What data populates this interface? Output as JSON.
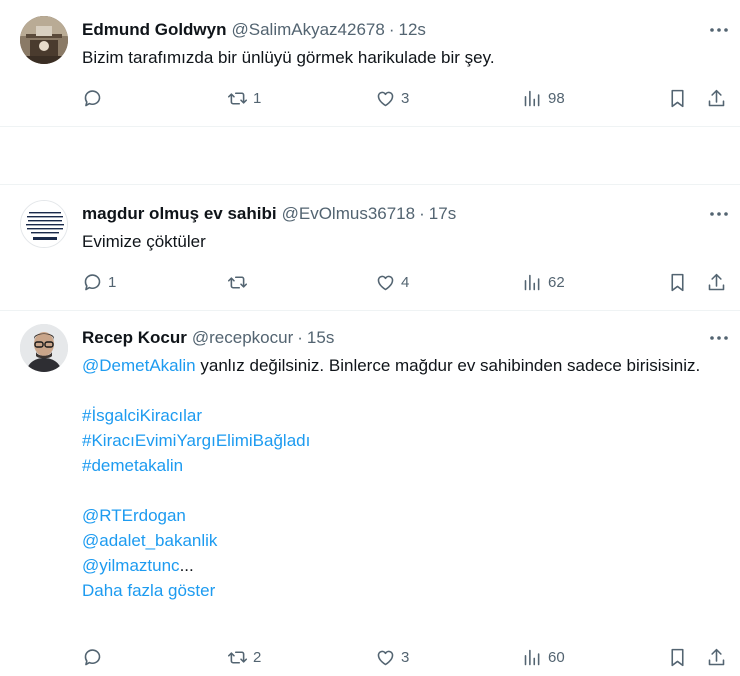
{
  "tweets": [
    {
      "name": "Edmund Goldwyn",
      "handle": "@SalimAkyaz42678",
      "time": "12s",
      "text": "Bizim tarafımızda bir ünlüyü görmek harikulade bir şey.",
      "replies": "",
      "retweets": "1",
      "likes": "3",
      "views": "98"
    },
    {
      "name": "magdur olmuş ev sahibi",
      "handle": "@EvOlmus36718",
      "time": "17s",
      "text": "Evimize çöktüler",
      "replies": "1",
      "retweets": "",
      "likes": "4",
      "views": "62",
      "avatar_text": "3 YILLIK SÖZLEŞMESİNİN KENDİLİĞİNDEN 10-12 SENE UZAMASI KABUL EDİLEMEZ."
    },
    {
      "name": "Recep Kocur",
      "handle": "@recepkocur",
      "time": "15s",
      "mention": "@DemetAkalin",
      "text_after_mention": " yanlız değilsiniz. Binlerce mağdur ev sahibinden sadece birisisiniz.",
      "hashtags": [
        "#İsgalciKiracılar",
        "#KiracıEvimiYargıElimiBağladı",
        "#demetakalin"
      ],
      "mentions": [
        "@RTErdogan",
        "@adalet_bakanlik",
        "@yilmaztunc"
      ],
      "ellipsis": "...",
      "show_more": "Daha fazla göster",
      "replies": "",
      "retweets": "2",
      "likes": "3",
      "views": "60"
    }
  ],
  "separator": "·",
  "colors": {
    "link": "#1d9bf0",
    "muted": "#536471",
    "text": "#0f1419",
    "divider": "#eff3f4"
  },
  "icons": [
    "reply-icon",
    "retweet-icon",
    "like-icon",
    "views-icon",
    "bookmark-icon",
    "share-icon",
    "more-icon"
  ]
}
